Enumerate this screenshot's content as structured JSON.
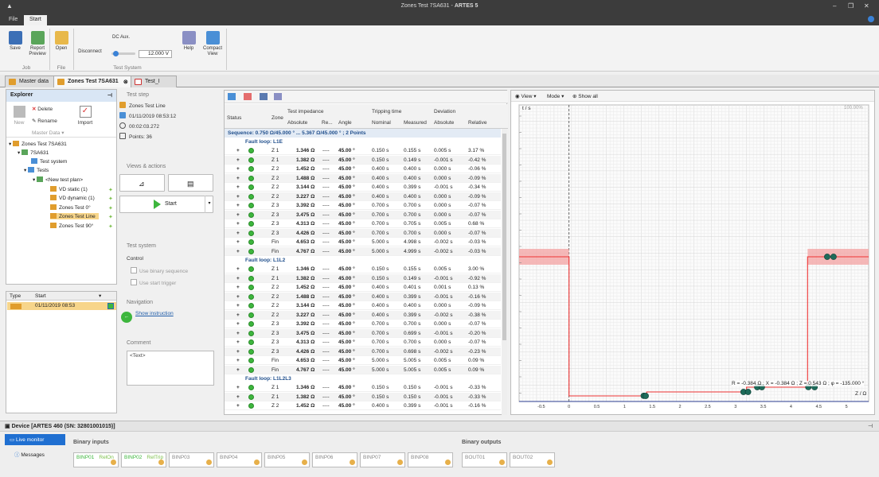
{
  "window": {
    "title_prefix": "Zones Test 7SA631",
    "title_sep": " - ",
    "title_app": "ARTES 5"
  },
  "menu": {
    "file": "File",
    "start": "Start"
  },
  "ribbon": {
    "save": "Save",
    "report_preview": "Report Preview",
    "open": "Open",
    "disconnect": "Disconnect",
    "dc_aux": "DC Aux.",
    "dc_value": "12.000 V",
    "help": "Help",
    "compact_view": "Compact View",
    "group_job": "Job",
    "group_file": "File",
    "group_test_system": "Test System"
  },
  "doc_tabs": [
    "Master data",
    "Zones Test 7SA631",
    "Test_I"
  ],
  "explorer": {
    "title": "Explorer",
    "delete": "Delete",
    "rename": "Rename",
    "new": "New",
    "master_data": "Master Data",
    "import": "Import",
    "tree": [
      "Zones Test 7SA631",
      "7SA631",
      "Test system",
      "Tests",
      "<New test plan>",
      "VD static (1)",
      "VD dynamic (1)",
      "Zones Test 0°",
      "Zones Test Line",
      "Zones Test 90°"
    ]
  },
  "type_list": {
    "col_type": "Type",
    "col_start": "Start",
    "row_start": "01/11/2019 08:53"
  },
  "test_step": {
    "title": "Test step",
    "name": "Zones Test Line",
    "date": "01/11/2019 08:53:12",
    "duration": "00:02:03.272",
    "points": "Points: 36"
  },
  "views": {
    "title": "Views & actions",
    "start": "Start"
  },
  "test_system": {
    "title": "Test system",
    "control": "Control",
    "use_binary": "Use binary sequence",
    "use_trigger": "Use start trigger"
  },
  "navigation": {
    "title": "Navigation",
    "show_instruction": "Show instruction"
  },
  "comment": {
    "title": "Comment",
    "placeholder": "<Text>"
  },
  "grid": {
    "col_status": "Status",
    "col_zone": "Zone",
    "col_test_impedance": "Test impedance",
    "col_tripping_time": "Tripping time",
    "col_deviation": "Deviation",
    "sub_absolute": "Absolute",
    "sub_re": "Re...",
    "sub_angle": "Angle",
    "sub_nominal": "Nominal",
    "sub_measured": "Measured",
    "sub_dev_abs": "Absolute",
    "sub_relative": "Relative",
    "sequence": "Sequence: 0.750 Ω/45.000 ° ... 5.367 Ω/45.000 ° ; 2 Points",
    "loops": [
      {
        "name": "Fault loop: L1E",
        "rows": [
          [
            "Z 1",
            "1.346 Ω",
            "45.00 °",
            "0.150 s",
            "0.155 s",
            "0.005 s",
            "3.17 %"
          ],
          [
            "Z 1",
            "1.382 Ω",
            "45.00 °",
            "0.150 s",
            "0.149 s",
            "-0.001 s",
            "-0.42 %"
          ],
          [
            "Z 2",
            "1.452 Ω",
            "45.00 °",
            "0.400 s",
            "0.400 s",
            "0.000 s",
            "-0.06 %"
          ],
          [
            "Z 2",
            "1.488 Ω",
            "45.00 °",
            "0.400 s",
            "0.400 s",
            "0.000 s",
            "-0.09 %"
          ],
          [
            "Z 2",
            "3.144 Ω",
            "45.00 °",
            "0.400 s",
            "0.399 s",
            "-0.001 s",
            "-0.34 %"
          ],
          [
            "Z 2",
            "3.227 Ω",
            "45.00 °",
            "0.400 s",
            "0.400 s",
            "0.000 s",
            "-0.09 %"
          ],
          [
            "Z 3",
            "3.392 Ω",
            "45.00 °",
            "0.700 s",
            "0.700 s",
            "0.000 s",
            "-0.07 %"
          ],
          [
            "Z 3",
            "3.475 Ω",
            "45.00 °",
            "0.700 s",
            "0.700 s",
            "0.000 s",
            "-0.07 %"
          ],
          [
            "Z 3",
            "4.313 Ω",
            "45.00 °",
            "0.700 s",
            "0.705 s",
            "0.005 s",
            "0.68 %"
          ],
          [
            "Z 3",
            "4.426 Ω",
            "45.00 °",
            "0.700 s",
            "0.700 s",
            "0.000 s",
            "-0.07 %"
          ],
          [
            "Fin",
            "4.653 Ω",
            "45.00 °",
            "5.000 s",
            "4.998 s",
            "-0.002 s",
            "-0.03 %"
          ],
          [
            "Fin",
            "4.767 Ω",
            "45.00 °",
            "5.000 s",
            "4.999 s",
            "-0.002 s",
            "-0.03 %"
          ]
        ]
      },
      {
        "name": "Fault loop: L1L2",
        "rows": [
          [
            "Z 1",
            "1.346 Ω",
            "45.00 °",
            "0.150 s",
            "0.155 s",
            "0.005 s",
            "3.00 %"
          ],
          [
            "Z 1",
            "1.382 Ω",
            "45.00 °",
            "0.150 s",
            "0.149 s",
            "-0.001 s",
            "-0.92 %"
          ],
          [
            "Z 2",
            "1.452 Ω",
            "45.00 °",
            "0.400 s",
            "0.401 s",
            "0.001 s",
            "0.13 %"
          ],
          [
            "Z 2",
            "1.488 Ω",
            "45.00 °",
            "0.400 s",
            "0.399 s",
            "-0.001 s",
            "-0.16 %"
          ],
          [
            "Z 2",
            "3.144 Ω",
            "45.00 °",
            "0.400 s",
            "0.400 s",
            "0.000 s",
            "-0.09 %"
          ],
          [
            "Z 2",
            "3.227 Ω",
            "45.00 °",
            "0.400 s",
            "0.399 s",
            "-0.002 s",
            "-0.38 %"
          ],
          [
            "Z 3",
            "3.392 Ω",
            "45.00 °",
            "0.700 s",
            "0.700 s",
            "0.000 s",
            "-0.07 %"
          ],
          [
            "Z 3",
            "3.475 Ω",
            "45.00 °",
            "0.700 s",
            "0.699 s",
            "-0.001 s",
            "-0.20 %"
          ],
          [
            "Z 3",
            "4.313 Ω",
            "45.00 °",
            "0.700 s",
            "0.700 s",
            "0.000 s",
            "-0.07 %"
          ],
          [
            "Z 3",
            "4.426 Ω",
            "45.00 °",
            "0.700 s",
            "0.698 s",
            "-0.002 s",
            "-0.23 %"
          ],
          [
            "Fin",
            "4.653 Ω",
            "45.00 °",
            "5.000 s",
            "5.005 s",
            "0.005 s",
            "0.09 %"
          ],
          [
            "Fin",
            "4.767 Ω",
            "45.00 °",
            "5.000 s",
            "5.005 s",
            "0.005 s",
            "0.09 %"
          ]
        ]
      },
      {
        "name": "Fault loop: L1L2L3",
        "rows": [
          [
            "Z 1",
            "1.346 Ω",
            "45.00 °",
            "0.150 s",
            "0.150 s",
            "-0.001 s",
            "-0.33 %"
          ],
          [
            "Z 1",
            "1.382 Ω",
            "45.00 °",
            "0.150 s",
            "0.150 s",
            "-0.001 s",
            "-0.33 %"
          ],
          [
            "Z 2",
            "1.452 Ω",
            "45.00 °",
            "0.400 s",
            "0.399 s",
            "-0.001 s",
            "-0.16 %"
          ]
        ]
      }
    ],
    "re_placeholder": "----"
  },
  "graph": {
    "view": "View",
    "mode": "Mode",
    "show_all": "Show all",
    "zoom": "100.00%",
    "ylabel": "t / s",
    "xlabel": "Z / Ω",
    "readout": "R = -0.384 Ω ; X = -0.384 Ω ; Z = 0.543 Ω ; φ = -135.000 °",
    "x_ticks": [
      "-0.5",
      "0",
      "0.5",
      "1",
      "1.5",
      "2",
      "2.5",
      "3",
      "3.5",
      "4",
      "4.5",
      "5"
    ]
  },
  "chart_data": {
    "type": "line",
    "xlabel": "Z / Ω",
    "ylabel": "t / s",
    "xlim": [
      -0.9,
      5.4
    ],
    "x_ticks": [
      -0.5,
      0,
      0.5,
      1,
      1.5,
      2,
      2.5,
      3,
      3.5,
      4,
      4.5,
      5
    ],
    "series": [
      {
        "x": [
          0,
          0,
          1.4,
          1.4,
          3.2,
          3.2,
          4.3,
          4.3,
          5.4
        ],
        "y": [
          5.0,
          0.15,
          0.15,
          0.4,
          0.4,
          0.7,
          0.7,
          5.0,
          5.0
        ]
      }
    ],
    "points": {
      "x": [
        1.346,
        1.382,
        3.144,
        3.227,
        3.392,
        3.475,
        4.313,
        4.426,
        4.653,
        4.767
      ],
      "y": [
        0.155,
        0.149,
        0.399,
        0.4,
        0.7,
        0.7,
        0.705,
        0.7,
        4.998,
        4.999
      ]
    }
  },
  "device": {
    "title": "Device [ARTES 460 (SN: 32801001015)]",
    "live_monitor": "Live monitor",
    "messages": "Messages",
    "binary_inputs": "Binary inputs",
    "binary_outputs": "Binary outputs",
    "inputs": [
      [
        "BINP01",
        "RelOn"
      ],
      [
        "BINP02",
        "RelTrip"
      ],
      [
        "BINP03",
        ""
      ],
      [
        "BINP04",
        ""
      ],
      [
        "BINP05",
        ""
      ],
      [
        "BINP06",
        ""
      ],
      [
        "BINP07",
        ""
      ],
      [
        "BINP08",
        ""
      ]
    ],
    "outputs": [
      "BOUT01",
      "BOUT02"
    ]
  }
}
